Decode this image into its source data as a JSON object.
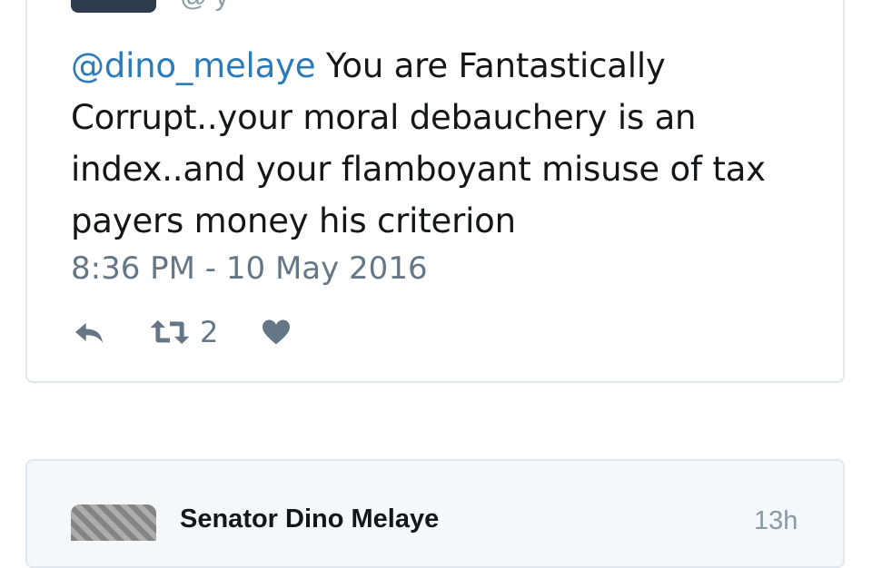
{
  "tweet": {
    "handle_partial": "@      y",
    "mention": "@dino_melaye",
    "body": " You are Fantastically Corrupt..your moral debauchery is an index..and your flamboyant misuse of tax payers money his criterion",
    "timestamp": "8:36 PM - 10 May 2016",
    "retweet_count": "2",
    "icons": [
      "reply-icon",
      "retweet-icon",
      "heart-icon"
    ]
  },
  "next_tweet": {
    "author": "Senator Dino Melaye",
    "time_ago": "13h"
  },
  "colors": {
    "mention": "#2b7bb9",
    "text": "#14171a",
    "muted": "#657786",
    "border": "#e1e8ed"
  }
}
